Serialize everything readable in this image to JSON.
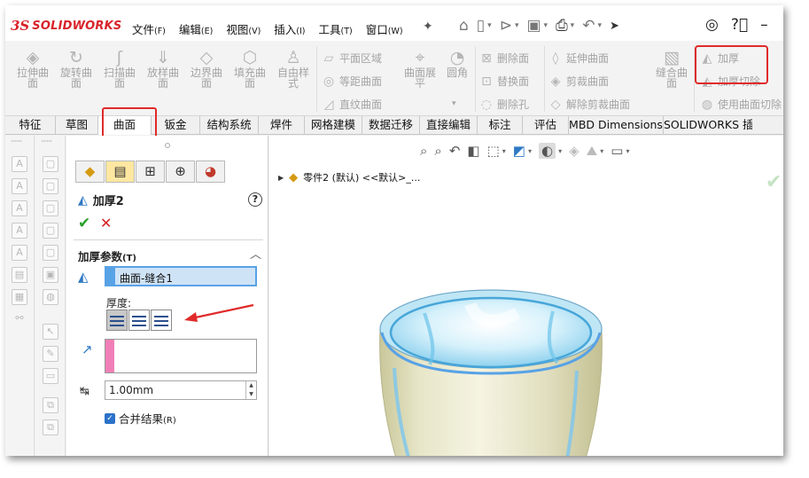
{
  "app": {
    "logo_mark": "3S",
    "name": "SOLIDWORKS"
  },
  "menus": [
    {
      "label": "文件",
      "key": "(F)"
    },
    {
      "label": "编辑",
      "key": "(E)"
    },
    {
      "label": "视图",
      "key": "(V)"
    },
    {
      "label": "插入",
      "key": "(I)"
    },
    {
      "label": "工具",
      "key": "(T)"
    },
    {
      "label": "窗口",
      "key": "(W)"
    }
  ],
  "quick_access": [
    "home-icon",
    "new-doc-icon",
    "open-icon",
    "save-icon",
    "print-icon",
    "undo-icon",
    "select-icon"
  ],
  "commands": {
    "big_buttons": [
      {
        "name": "拉伸曲面",
        "l1": "拉伸曲",
        "l2": "面",
        "icon": "extrude-surface-icon"
      },
      {
        "name": "旋转曲面",
        "l1": "旋转曲",
        "l2": "面",
        "icon": "revolve-surface-icon"
      },
      {
        "name": "扫描曲面",
        "l1": "扫描曲",
        "l2": "面",
        "icon": "sweep-surface-icon"
      },
      {
        "name": "放样曲面",
        "l1": "放样曲",
        "l2": "面",
        "icon": "loft-surface-icon"
      },
      {
        "name": "边界曲面",
        "l1": "边界曲",
        "l2": "面",
        "icon": "boundary-surface-icon"
      },
      {
        "name": "填充曲面",
        "l1": "填充曲",
        "l2": "面",
        "icon": "fill-surface-icon"
      },
      {
        "name": "自由样式",
        "l1": "自由样",
        "l2": "式",
        "icon": "freeform-icon"
      }
    ],
    "col2": [
      "平面区域",
      "等距曲面",
      "直纹曲面"
    ],
    "unfold": {
      "l1": "曲面展",
      "l2": "平"
    },
    "fillet": "圆角",
    "col3": [
      "删除面",
      "替换面",
      "删除孔"
    ],
    "col4": [
      "延伸曲面",
      "剪裁曲面",
      "解除剪裁曲面"
    ],
    "knit": {
      "l1": "缝合曲",
      "l2": "面"
    },
    "col5": [
      "加厚",
      "加厚切除",
      "使用曲面切除"
    ]
  },
  "tabs": [
    "特征",
    "草图",
    "曲面",
    "钣金",
    "结构系统",
    "焊件",
    "网格建模",
    "数据迁移",
    "直接编辑",
    "标注",
    "评估",
    "MBD Dimensions",
    "SOLIDWORKS 插件"
  ],
  "active_tab": "曲面",
  "property_manager": {
    "title": "加厚2",
    "section_title": "加厚参数",
    "section_key": "(T)",
    "face": "曲面-缝合1",
    "thickness_label": "厚度:",
    "thickness": "1.00mm",
    "merge_label": "合并结果",
    "merge_key": "(R)",
    "merge_checked": true
  },
  "feature_tree": {
    "root": "零件2 (默认) <<默认>_..."
  },
  "colors": {
    "highlight": "#e02a2a",
    "selection_blue": "#58a2e6",
    "direction_pink": "#f07fb7",
    "ok_green": "#2aa02a"
  }
}
